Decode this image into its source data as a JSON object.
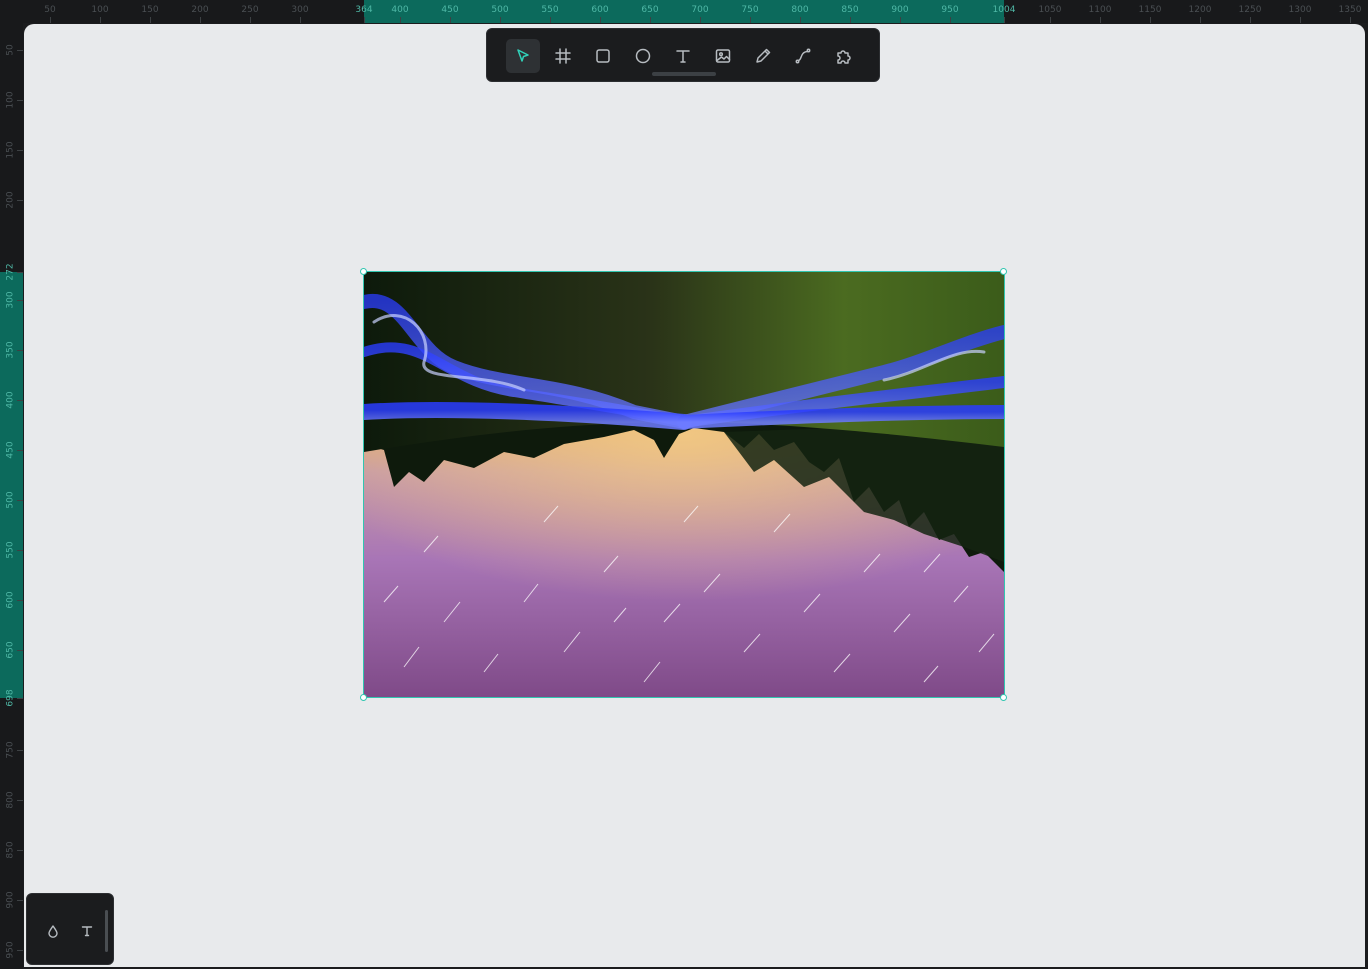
{
  "rulers": {
    "top": {
      "ticks": [
        "50",
        "100",
        "150",
        "200",
        "250",
        "300",
        "364",
        "400",
        "450",
        "500",
        "550",
        "600",
        "650",
        "700",
        "750",
        "800",
        "850",
        "900",
        "950",
        "1004",
        "1050",
        "1100",
        "1150",
        "1200",
        "1250",
        "1300",
        "1350"
      ],
      "highlight_start": "364",
      "highlight_end": "1004"
    },
    "left": {
      "ticks": [
        "50",
        "100",
        "150",
        "200",
        "272",
        "300",
        "350",
        "400",
        "450",
        "500",
        "550",
        "600",
        "650",
        "698",
        "750",
        "800",
        "850",
        "900",
        "950"
      ],
      "highlight_start": "272",
      "highlight_end": "698"
    },
    "highlight_color": "#0c6a5c"
  },
  "toolbar": {
    "tools": [
      {
        "name": "select-tool",
        "icon": "pointer-icon",
        "active": true
      },
      {
        "name": "frame-tool",
        "icon": "frame-icon",
        "active": false
      },
      {
        "name": "rectangle-tool",
        "icon": "square-icon",
        "active": false
      },
      {
        "name": "ellipse-tool",
        "icon": "circle-icon",
        "active": false
      },
      {
        "name": "text-tool",
        "icon": "text-icon",
        "active": false
      },
      {
        "name": "image-tool",
        "icon": "image-icon",
        "active": false
      },
      {
        "name": "pencil-tool",
        "icon": "pencil-icon",
        "active": false
      },
      {
        "name": "path-tool",
        "icon": "path-curve-icon",
        "active": false
      },
      {
        "name": "plugins-tool",
        "icon": "puzzle-icon",
        "active": false
      }
    ],
    "accent_color": "#31d1b9"
  },
  "canvas": {
    "background": "#e8eaec",
    "image": {
      "subject": "upside-down night landscape with light-painted trails reflecting in a lake",
      "selected": true,
      "selection_color": "#31c6b0"
    }
  },
  "palette": {
    "buttons": [
      {
        "name": "color-palette-button",
        "icon": "drop-icon"
      },
      {
        "name": "typography-button",
        "icon": "text-icon"
      }
    ]
  }
}
